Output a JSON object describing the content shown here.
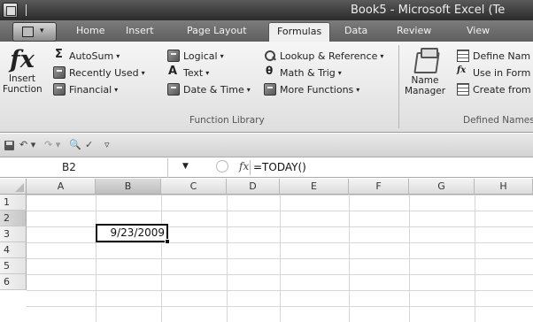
{
  "window": {
    "title": "Book5 - Microsoft Excel (Te"
  },
  "ribbon_tabs": [
    "Home",
    "Insert",
    "Page Layout",
    "Formulas",
    "Data",
    "Review",
    "View"
  ],
  "active_tab": "Formulas",
  "ribbon": {
    "insert_function": {
      "line1": "Insert",
      "line2": "Function"
    },
    "function_library": {
      "label": "Function Library",
      "items": [
        {
          "label": "AutoSum",
          "icon": "sigma-icon"
        },
        {
          "label": "Recently Used",
          "icon": "book-icon"
        },
        {
          "label": "Financial",
          "icon": "book-icon"
        },
        {
          "label": "Logical",
          "icon": "book-icon"
        },
        {
          "label": "Text",
          "icon": "text-icon"
        },
        {
          "label": "Date & Time",
          "icon": "book-icon"
        },
        {
          "label": "Lookup & Reference",
          "icon": "magnifier-icon"
        },
        {
          "label": "Math & Trig",
          "icon": "theta-icon"
        },
        {
          "label": "More Functions",
          "icon": "book-icon"
        }
      ]
    },
    "defined_names": {
      "label": "Defined Names",
      "name_manager": {
        "line1": "Name",
        "line2": "Manager"
      },
      "items": [
        "Define Nam",
        "Use in Form",
        "Create from"
      ]
    }
  },
  "formula_bar": {
    "name_box": "B2",
    "formula": "=TODAY()"
  },
  "grid": {
    "columns": [
      "A",
      "B",
      "C",
      "D",
      "E",
      "F",
      "G",
      "H"
    ],
    "rows": [
      "1",
      "2",
      "3",
      "4",
      "5",
      "6"
    ],
    "selected_column": "B",
    "selected_row": "2",
    "active_cell_value": "9/23/2009"
  }
}
